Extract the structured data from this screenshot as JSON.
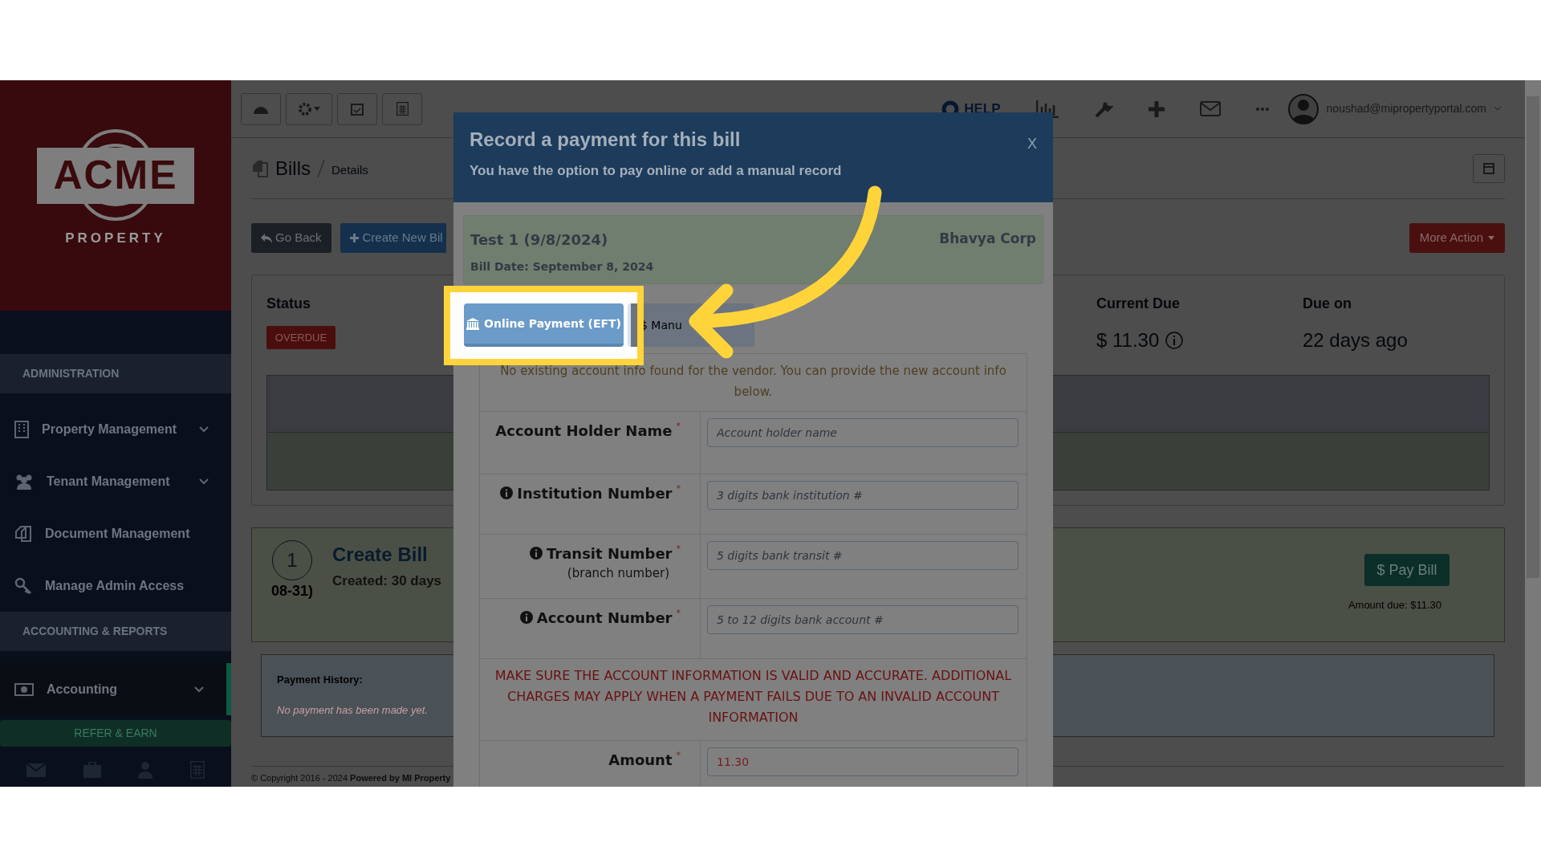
{
  "sidebar": {
    "logo": {
      "word": "ACME",
      "tagline": "PROPERTY"
    },
    "sections": [
      {
        "heading": "ADMINISTRATION",
        "items": [
          {
            "label": "Property Management",
            "expandable": true,
            "selected": false
          },
          {
            "label": "Tenant Management",
            "expandable": true,
            "selected": false
          },
          {
            "label": "Document Management",
            "expandable": false,
            "selected": false
          },
          {
            "label": "Manage Admin Access",
            "expandable": false,
            "selected": false
          }
        ]
      },
      {
        "heading": "ACCOUNTING & REPORTS",
        "items": [
          {
            "label": "Accounting",
            "expandable": true,
            "selected": true
          }
        ]
      }
    ],
    "refer_button": "REFER & EARN"
  },
  "topbar": {
    "help": "HELP",
    "user_email": "noushad@mipropertyportal.com"
  },
  "page": {
    "breadcrumb": {
      "title": "Bills",
      "sub": "Details"
    },
    "buttons": {
      "back": "Go Back",
      "create": "Create New Bil",
      "more": "More Action"
    },
    "status": {
      "label": "Status",
      "badge": "OVERDUE",
      "current_due_label": "Current Due",
      "current_due": "$ 11.30",
      "due_on_label": "Due on",
      "due_on": "22 days ago"
    },
    "timeline": {
      "step": "1",
      "title": "Create Bill",
      "created": "Created: 30 days",
      "date_tail": "08-31)",
      "pay_button": "$ Pay Bill",
      "amount_due": "Amount due: $11.30"
    },
    "payment_history": {
      "label": "Payment History:",
      "empty": "No payment has been made yet."
    },
    "footer": {
      "copyright": "© Copyright 2016 - 2024",
      "powered": "Powered by MI Property"
    }
  },
  "modal": {
    "title": "Record a payment for this bill",
    "subtitle": "You have the option to pay online or add a manual record",
    "close": "X",
    "bill": {
      "name": "Test 1 (9/8/2024)",
      "date": "Bill Date: September 8, 2024",
      "vendor": "Bhavya Corp"
    },
    "tabs": [
      {
        "label": "Online Payment (EFT)",
        "selected": true
      },
      {
        "label": "$ Manu",
        "selected": false
      }
    ],
    "notice": "No existing account info found for the vendor. You can provide the new account info below.",
    "fields": [
      {
        "label": "Account Holder Name",
        "info": false,
        "required_mark": "*",
        "placeholder": "Account holder name"
      },
      {
        "label": "Institution Number",
        "info": true,
        "required_mark": "*",
        "placeholder": "3 digits bank institution #"
      },
      {
        "label": "Transit Number",
        "sublabel": "(branch number)",
        "info": true,
        "required_mark": "*",
        "placeholder": "5 digits bank transit #"
      },
      {
        "label": "Account Number",
        "info": true,
        "required_mark": "*",
        "placeholder": "5 to 12 digits bank account #"
      }
    ],
    "warning": "MAKE SURE THE ACCOUNT INFORMATION IS VALID AND ACCURATE. ADDITIONAL CHARGES MAY APPLY WHEN A PAYMENT FAILS DUE TO AN INVALID ACCOUNT INFORMATION",
    "amount": {
      "label": "Amount",
      "required_mark": "*",
      "value": "11.30"
    }
  }
}
